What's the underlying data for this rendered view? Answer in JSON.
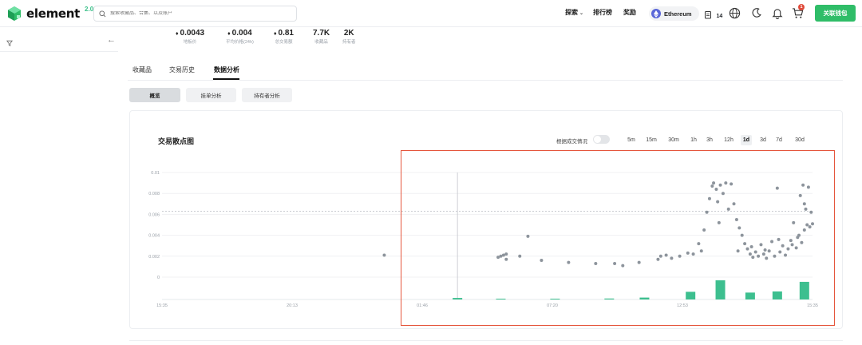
{
  "header": {
    "logo_text": "element",
    "logo_version": "2.0",
    "search_placeholder": "搜索收藏品、合集、以及账户",
    "nav": [
      {
        "label": "探索",
        "has_dropdown": true
      },
      {
        "label": "排行榜"
      },
      {
        "label": "奖励"
      }
    ],
    "chain_label": "Ethereum",
    "badge_count": "14",
    "cart_count": "1",
    "connect_label": "关联钱包",
    "accent_color": "#2fbd68"
  },
  "stats": [
    {
      "value": "0.0043",
      "label": "地板价",
      "eth": true
    },
    {
      "value": "0.004",
      "label": "平均价格(24h)",
      "eth": true
    },
    {
      "value": "0.81",
      "label": "总交易额",
      "eth": true
    },
    {
      "value": "7.7K",
      "label": "收藏品",
      "eth": false
    },
    {
      "value": "2K",
      "label": "持有者",
      "eth": false
    }
  ],
  "tabs": [
    {
      "label": "收藏品",
      "active": false
    },
    {
      "label": "交易历史",
      "active": false
    },
    {
      "label": "数据分析",
      "active": true
    }
  ],
  "subtabs": [
    {
      "label": "概览",
      "active": true
    },
    {
      "label": "挂单分析",
      "active": false
    },
    {
      "label": "持有者分析",
      "active": false
    }
  ],
  "chart_panel": {
    "title": "交易散点图",
    "toggle_label": "根据成交情况",
    "toggle_on": false,
    "timeframes": [
      "5m",
      "15m",
      "30m",
      "1h",
      "3h",
      "12h",
      "1d",
      "3d",
      "7d",
      "30d"
    ],
    "active_timeframe": "1d"
  },
  "chart_data": {
    "type": "scatter",
    "title": "交易散点图",
    "xlabel": "",
    "ylabel": "",
    "x_ticks": [
      "15:35",
      "20:13",
      "01:46",
      "07:20",
      "12:53",
      "15:35"
    ],
    "y_ticks": [
      "0.01",
      "0.008",
      "0.006",
      "0.004",
      "0.002",
      "0"
    ],
    "ylim": [
      0,
      0.01
    ],
    "xlim": [
      0,
      24
    ],
    "reference_line": 0.0063,
    "crosshair_x": 10.9,
    "grid": true,
    "point_color": "#8d949c",
    "bar_color": "#3dbf8f",
    "points": [
      [
        8.2,
        0.0021
      ],
      [
        12.4,
        0.0019
      ],
      [
        12.5,
        0.002
      ],
      [
        12.6,
        0.0021
      ],
      [
        12.7,
        0.0017
      ],
      [
        12.7,
        0.0022
      ],
      [
        13.2,
        0.002
      ],
      [
        13.5,
        0.0039
      ],
      [
        14.0,
        0.0016
      ],
      [
        15.0,
        0.0014
      ],
      [
        16.0,
        0.0013
      ],
      [
        16.7,
        0.0013
      ],
      [
        17.0,
        0.0011
      ],
      [
        17.6,
        0.0014
      ],
      [
        18.3,
        0.0017
      ],
      [
        18.4,
        0.002
      ],
      [
        18.6,
        0.0021
      ],
      [
        18.8,
        0.0018
      ],
      [
        19.1,
        0.002
      ],
      [
        19.4,
        0.0023
      ],
      [
        19.6,
        0.0022
      ],
      [
        19.8,
        0.0032
      ],
      [
        19.9,
        0.0025
      ],
      [
        20.0,
        0.0045
      ],
      [
        20.1,
        0.0062
      ],
      [
        20.2,
        0.0075
      ],
      [
        20.3,
        0.0087
      ],
      [
        20.35,
        0.009
      ],
      [
        20.45,
        0.0084
      ],
      [
        20.5,
        0.0072
      ],
      [
        20.6,
        0.0088
      ],
      [
        20.7,
        0.008
      ],
      [
        20.8,
        0.009
      ],
      [
        20.9,
        0.0065
      ],
      [
        21.0,
        0.0089
      ],
      [
        21.1,
        0.007
      ],
      [
        21.2,
        0.0055
      ],
      [
        21.3,
        0.0047
      ],
      [
        21.4,
        0.004
      ],
      [
        21.5,
        0.0032
      ],
      [
        21.6,
        0.0027
      ],
      [
        21.7,
        0.0022
      ],
      [
        21.8,
        0.0019
      ],
      [
        21.9,
        0.0024
      ],
      [
        22.0,
        0.002
      ],
      [
        22.1,
        0.0031
      ],
      [
        22.2,
        0.0022
      ],
      [
        22.3,
        0.0018
      ],
      [
        22.4,
        0.0025
      ],
      [
        22.5,
        0.0034
      ],
      [
        22.6,
        0.002
      ],
      [
        22.7,
        0.0085
      ],
      [
        22.8,
        0.0024
      ],
      [
        22.9,
        0.003
      ],
      [
        23.0,
        0.0021
      ],
      [
        23.1,
        0.0027
      ],
      [
        23.2,
        0.0035
      ],
      [
        23.3,
        0.0052
      ],
      [
        23.4,
        0.0028
      ],
      [
        23.5,
        0.004
      ],
      [
        23.55,
        0.0078
      ],
      [
        23.6,
        0.0033
      ],
      [
        23.65,
        0.0088
      ],
      [
        23.7,
        0.0045
      ],
      [
        23.75,
        0.0065
      ],
      [
        23.8,
        0.005
      ],
      [
        23.85,
        0.0086
      ],
      [
        23.9,
        0.0048
      ],
      [
        23.95,
        0.0062
      ],
      [
        24.0,
        0.0051
      ],
      [
        21.25,
        0.0025
      ],
      [
        21.75,
        0.0029
      ],
      [
        22.25,
        0.0026
      ],
      [
        22.75,
        0.0036
      ],
      [
        23.25,
        0.0031
      ],
      [
        23.45,
        0.0038
      ],
      [
        23.7,
        0.007
      ],
      [
        20.55,
        0.0052
      ]
    ],
    "volume_bars": [
      {
        "x": 10.9,
        "v": 0.08
      },
      {
        "x": 12.5,
        "v": 0.03
      },
      {
        "x": 14.5,
        "v": 0.04
      },
      {
        "x": 16.5,
        "v": 0.05
      },
      {
        "x": 17.8,
        "v": 0.1
      },
      {
        "x": 19.5,
        "v": 0.4
      },
      {
        "x": 20.6,
        "v": 1.0
      },
      {
        "x": 21.7,
        "v": 0.36
      },
      {
        "x": 22.7,
        "v": 0.42
      },
      {
        "x": 23.7,
        "v": 0.92
      }
    ]
  }
}
